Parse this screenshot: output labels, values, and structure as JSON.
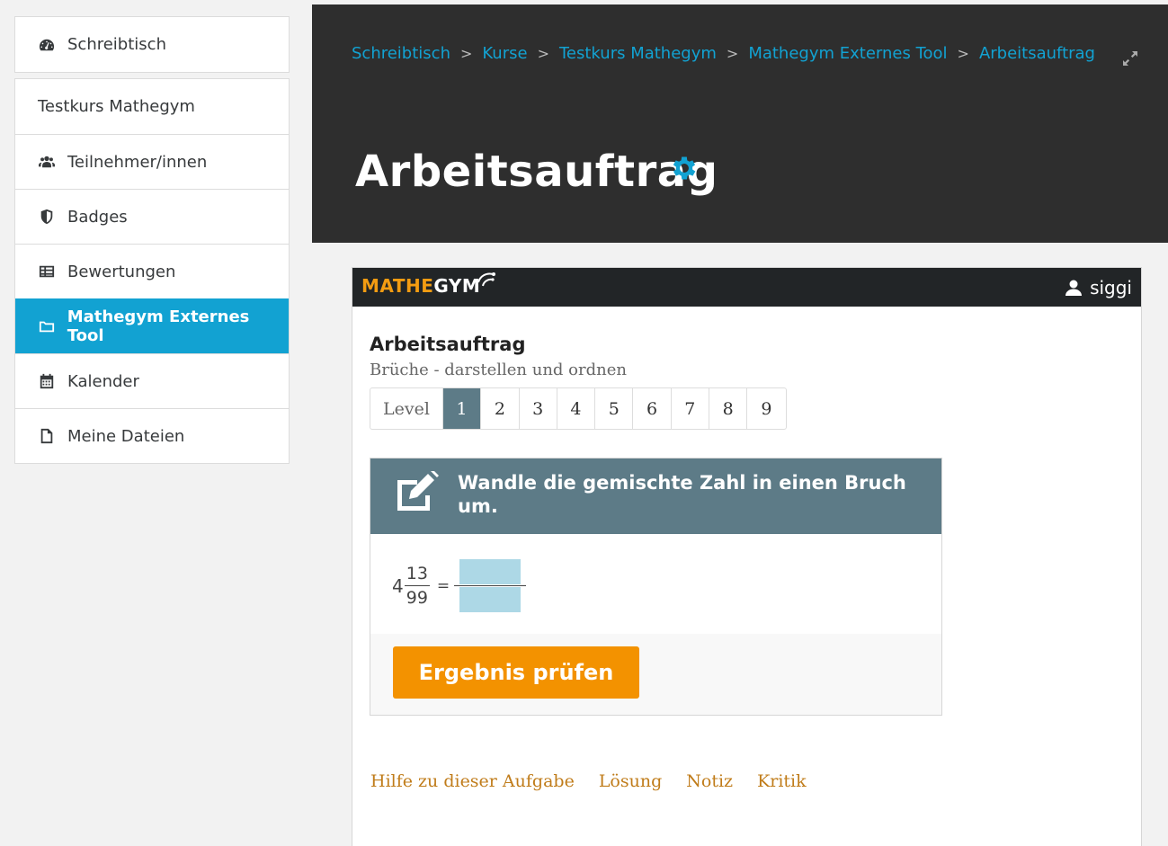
{
  "sidebar": {
    "top": {
      "label": "Schreibtisch",
      "icon": "dashboard-icon"
    },
    "course": {
      "label": "Testkurs Mathegym"
    },
    "items": [
      {
        "label": "Teilnehmer/innen",
        "icon": "users-icon"
      },
      {
        "label": "Badges",
        "icon": "shield-icon"
      },
      {
        "label": "Bewertungen",
        "icon": "table-icon"
      },
      {
        "label": "Mathegym Externes Tool",
        "icon": "folder-icon",
        "active": true
      },
      {
        "label": "Kalender",
        "icon": "calendar-icon"
      },
      {
        "label": "Meine Dateien",
        "icon": "file-icon"
      }
    ]
  },
  "header": {
    "breadcrumb": [
      "Schreibtisch",
      "Kurse",
      "Testkurs Mathegym",
      "Mathegym Externes Tool",
      "Arbeitsauftrag"
    ],
    "separator": ">",
    "title": "Arbeitsauftrag"
  },
  "mathegym": {
    "logo_part1": "MATHE",
    "logo_part2": "GYM",
    "user": "siggi",
    "task_heading": "Arbeitsauftrag",
    "task_topic": "Brüche - darstellen und ordnen",
    "level_label": "Level",
    "levels": [
      "1",
      "2",
      "3",
      "4",
      "5",
      "6",
      "7",
      "8",
      "9"
    ],
    "active_level": "1",
    "exercise": {
      "instruction": "Wandle die gemischte Zahl in einen Bruch um.",
      "whole": "4",
      "numerator": "13",
      "denominator": "99",
      "equals": "=",
      "check_button": "Ergebnis prüfen"
    },
    "footer_links": [
      "Hilfe zu dieser Aufgabe",
      "Lösung",
      "Notiz",
      "Kritik"
    ]
  },
  "colors": {
    "accent": "#12a2d2",
    "header_bg": "#2e2e2e",
    "exercise_head": "#5d7b87",
    "button": "#f39200",
    "answer_box": "#add8e6",
    "link": "#c07c1a"
  }
}
